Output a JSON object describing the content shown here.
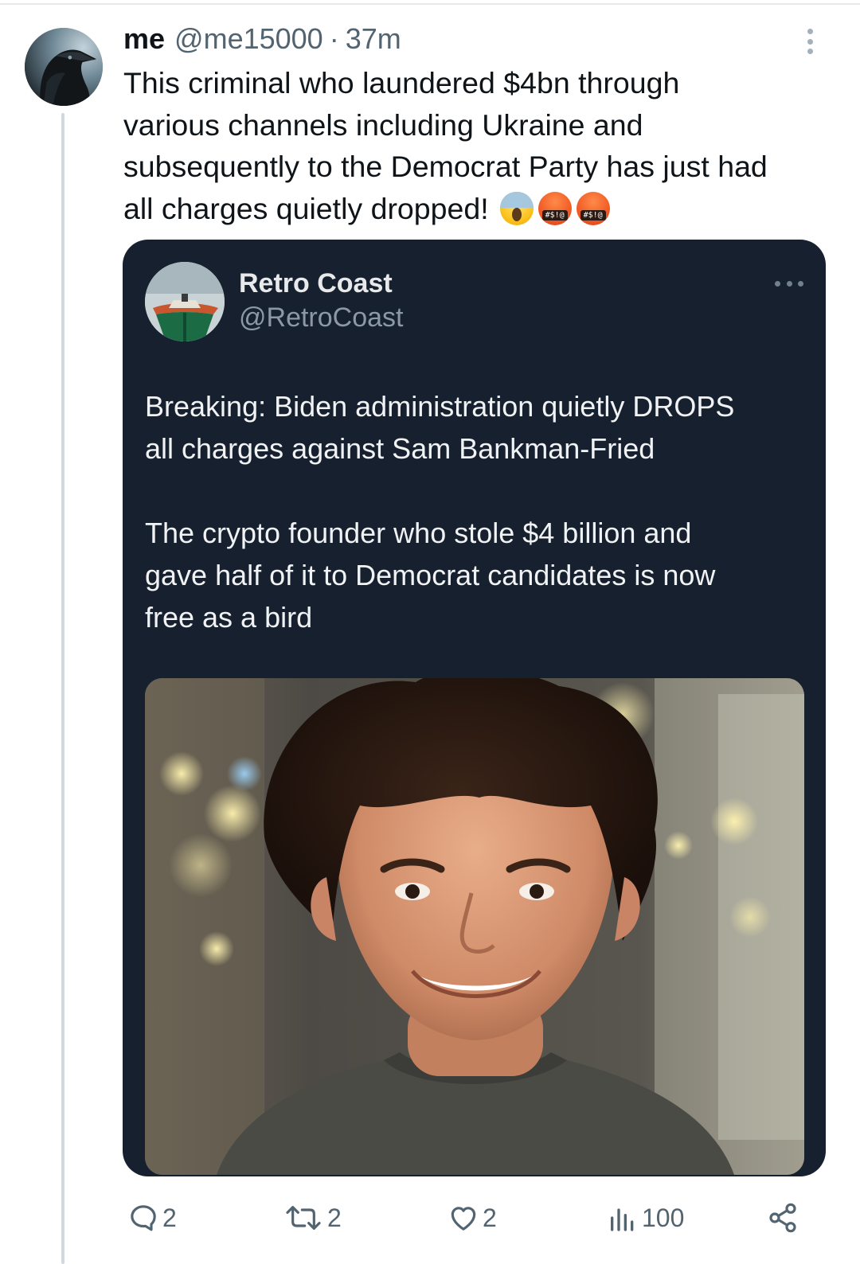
{
  "tweet": {
    "author_name": "me",
    "author_handle": "@me15000",
    "separator": "·",
    "time": "37m",
    "text_lines": [
      "This criminal who laundered $4bn through",
      "various channels including Ukraine and",
      "subsequently to the Democrat Party has just had",
      "all charges quietly dropped!"
    ],
    "emojis": [
      "face-screaming-in-fear",
      "face-with-symbols-on-mouth",
      "face-with-symbols-on-mouth"
    ]
  },
  "quoted_tweet": {
    "author_name": "Retro Coast",
    "author_handle": "@RetroCoast",
    "paragraph_1": [
      "Breaking: Biden administration quietly DROPS",
      "all charges against Sam Bankman-Fried"
    ],
    "paragraph_2": [
      "The crypto founder who stole $4 billion and",
      "gave half of it to Democrat candidates is now",
      "free as a bird"
    ],
    "media": "photo-of-curly-haired-man-smiling"
  },
  "actions": {
    "reply_count": "2",
    "repost_count": "2",
    "like_count": "2",
    "views_count": "100"
  },
  "icons": {
    "reply": "speech-bubble-icon",
    "repost": "repost-arrows-icon",
    "like": "heart-icon",
    "views": "bar-chart-icon",
    "share": "share-nodes-icon",
    "more": "vertical-ellipsis-icon"
  },
  "colors": {
    "background": "#ffffff",
    "text_primary": "#0f1419",
    "text_secondary": "#536471",
    "quote_card_bg": "#16202e",
    "quote_text": "#f0f2f4",
    "thread_line": "#cfd9de"
  }
}
